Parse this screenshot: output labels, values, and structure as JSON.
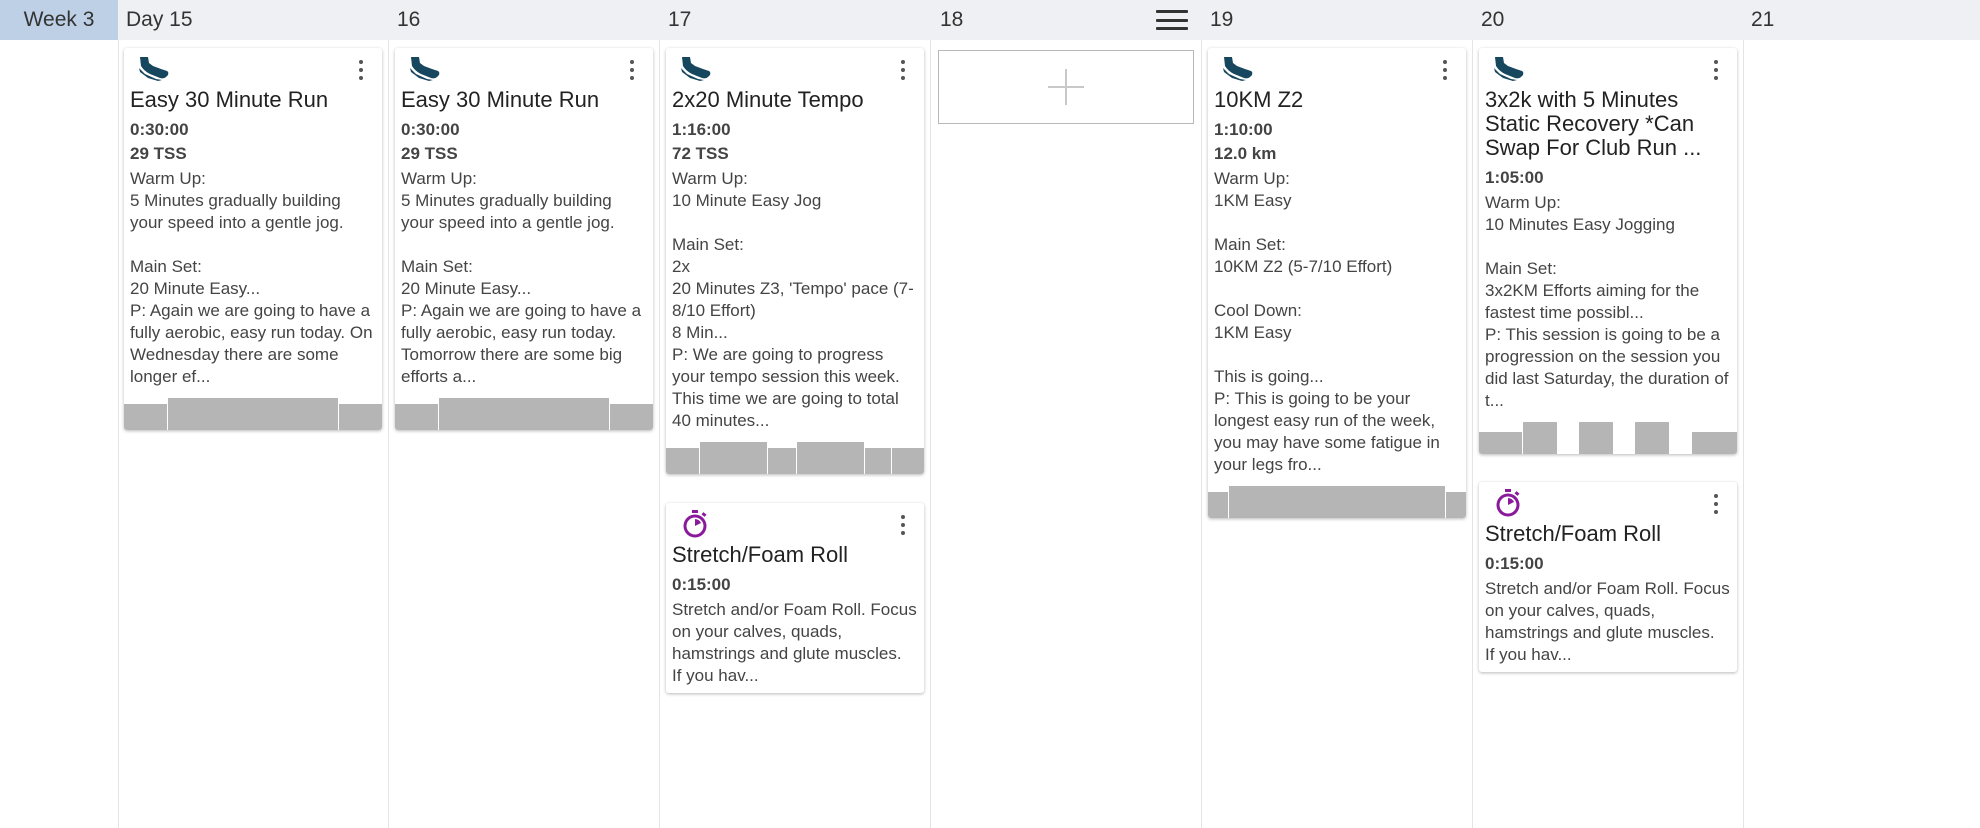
{
  "header": {
    "week_label": "Week 3",
    "days": [
      "Day 15",
      "16",
      "17",
      "18",
      "19",
      "20",
      "21"
    ],
    "menu_icon": "hamburger-menu-icon"
  },
  "colors": {
    "run_icon": "#17475e",
    "stretch_icon": "#8a1a9b",
    "bars": "#b5b5b5",
    "week_header": "#bdd0e6"
  },
  "days": {
    "d15": {
      "workouts": [
        {
          "icon": "running-shoe-icon",
          "title": "Easy 30 Minute Run",
          "duration": "0:30:00",
          "tss": "29 TSS",
          "description": "Warm Up:\n5 Minutes gradually building your speed into a gentle jog.\n\nMain Set:\n20 Minute Easy...\nP: Again we are going to have a fully aerobic, easy run today. On Wednesday there are some longer ef..."
        }
      ]
    },
    "d16": {
      "workouts": [
        {
          "icon": "running-shoe-icon",
          "title": "Easy 30 Minute Run",
          "duration": "0:30:00",
          "tss": "29 TSS",
          "description": "Warm Up:\n5 Minutes gradually building your speed into a gentle jog.\n\nMain Set:\n20 Minute Easy...\nP: Again we are going to have a fully aerobic, easy run today. Tomorrow there are some big efforts a..."
        }
      ]
    },
    "d17": {
      "workouts": [
        {
          "icon": "running-shoe-icon",
          "title": "2x20 Minute Tempo",
          "duration": "1:16:00",
          "tss": "72 TSS",
          "description": "Warm Up:\n10 Minute Easy Jog\n\nMain Set:\n2x\n20 Minutes Z3, 'Tempo' pace (7-8/10 Effort)\n8 Min...\nP: We are going to progress your tempo session this week. This time we are going to total 40 minutes..."
        },
        {
          "icon": "stopwatch-icon",
          "title": "Stretch/Foam Roll",
          "duration": "0:15:00",
          "description": "Stretch and/or Foam Roll. Focus on your calves, quads, hamstrings and glute muscles.\nIf you hav..."
        }
      ]
    },
    "d18": {
      "add_icon": "plus-icon"
    },
    "d19": {
      "workouts": [
        {
          "icon": "running-shoe-icon",
          "title": "10KM Z2",
          "duration": "1:10:00",
          "distance": "12.0 km",
          "description": "Warm Up:\n1KM Easy\n\nMain Set:\n10KM Z2 (5-7/10 Effort)\n\nCool Down:\n1KM Easy\n\nThis is going...\nP: This is going to be your longest easy run of the week, you may have some fatigue in your legs fro..."
        }
      ]
    },
    "d20": {
      "workouts": [
        {
          "icon": "running-shoe-icon",
          "title": "3x2k with 5 Minutes Static Recovery *Can Swap For Club Run ...",
          "duration": "1:05:00",
          "description": "Warm Up:\n10 Minutes Easy Jogging\n\nMain Set:\n3x2KM Efforts aiming for the fastest time possibl...\nP: This session is going to be a progression on the session you did last Saturday, the duration of t..."
        },
        {
          "icon": "stopwatch-icon",
          "title": "Stretch/Foam Roll",
          "duration": "0:15:00",
          "description": "Stretch and/or Foam Roll. Focus on your calves, quads, hamstrings and glute muscles.\nIf you hav..."
        }
      ]
    }
  }
}
